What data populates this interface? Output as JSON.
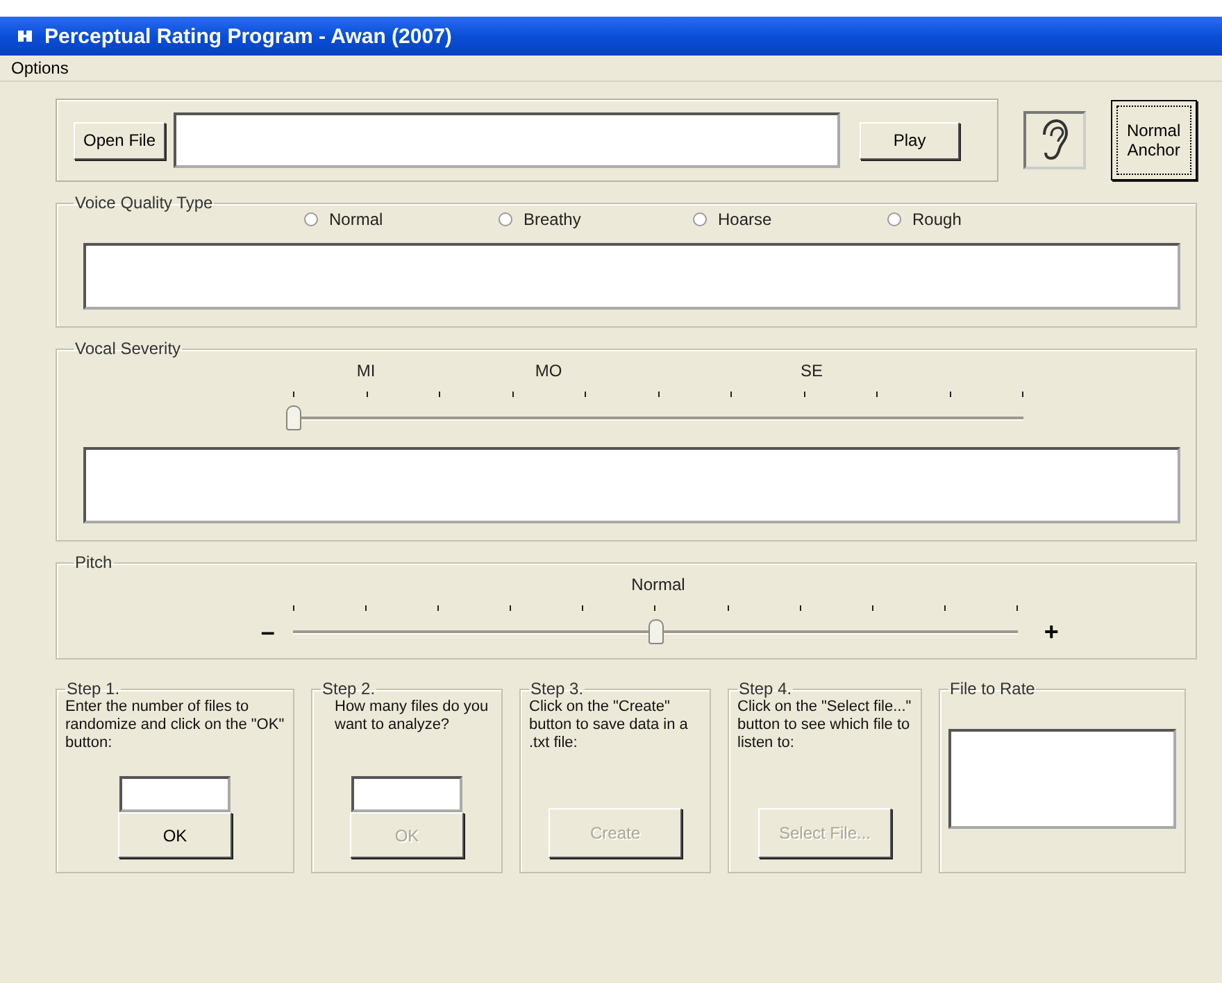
{
  "window": {
    "title": "Perceptual Rating Program - Awan (2007)"
  },
  "menu": [
    "Options"
  ],
  "file_bar": {
    "open_button": "Open File",
    "play_button": "Play",
    "anchor_button": "Normal Anchor"
  },
  "voice_quality": {
    "title": "Voice Quality Type",
    "options": [
      {
        "label": "Normal",
        "selected": false
      },
      {
        "label": "Breathy",
        "selected": false
      },
      {
        "label": "Hoarse",
        "selected": false
      },
      {
        "label": "Rough",
        "selected": false
      }
    ]
  },
  "vocal_severity": {
    "title": "Vocal Severity",
    "scale_labels": [
      "MI",
      "MO",
      "SE"
    ],
    "level": 0
  },
  "pitch": {
    "title": "Pitch",
    "center_label": "Normal",
    "minus": "–",
    "plus": "+",
    "level": 0.5
  },
  "steps": [
    {
      "title": "Step 1.",
      "text": "Enter the number of files to randomize and click on the \"OK\" button:",
      "has_input": true,
      "button": "OK",
      "disabled": false
    },
    {
      "title": "Step 2.",
      "text": "How many files do you want to analyze?",
      "has_input": true,
      "button": "OK",
      "disabled": true
    },
    {
      "title": "Step 3.",
      "text": "Click on the \"Create\" button to save data in a .txt file:",
      "has_input": false,
      "button": "Create",
      "disabled": true
    },
    {
      "title": "Step 4.",
      "text": "Click on the \"Select file...\" button to see which file to listen to:",
      "has_input": false,
      "button": "Select File...",
      "disabled": true
    }
  ],
  "file_to_rate": {
    "title": "File to Rate"
  }
}
